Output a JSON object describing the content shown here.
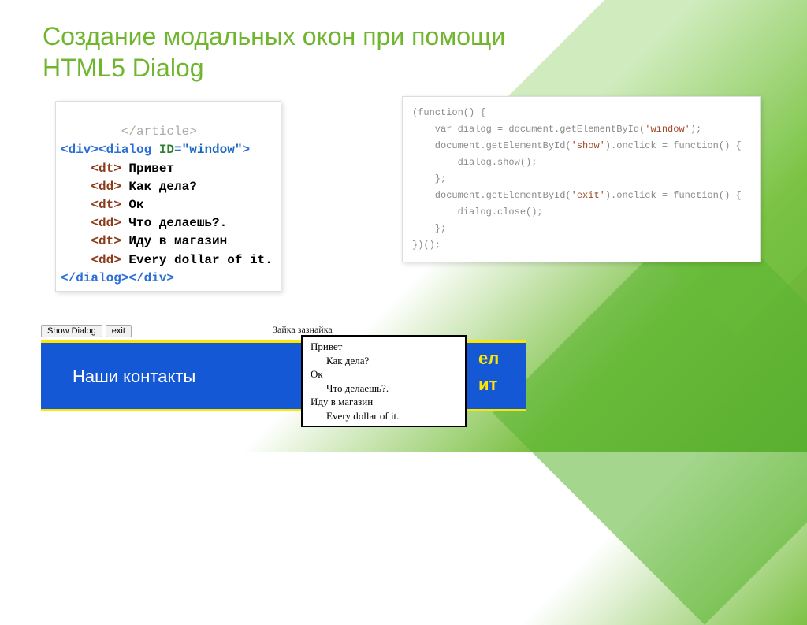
{
  "title_line1": "Создание модальных окон при помощи",
  "title_line2": "HTML5 Dialog",
  "code_left": {
    "l0": "</article>",
    "open_div": "<div>",
    "open_dialog": "<dialog ",
    "attr_id": "ID",
    "eq": "=",
    "val_window": "\"window\"",
    "gt": ">",
    "dt1a": "<dt>",
    "dt1t": " Привет",
    "dd1a": "<dd>",
    "dd1t": " Как дела?",
    "dt2a": "<dt>",
    "dt2t": " Ок",
    "dd2a": "<dd>",
    "dd2t": " Что делаешь?.",
    "dt3a": "<dt>",
    "dt3t": " Иду в магазин",
    "dd3a": "<dd>",
    "dd3t": " Every dollar of it.",
    "close_dialog": "</dialog>",
    "close_div": "</div>"
  },
  "code_right": {
    "l1": "(function() {",
    "l2a": "    var dialog = document.getElementById(",
    "l2s": "'window'",
    "l2b": ");",
    "l3a": "    document.getElementById(",
    "l3s": "'show'",
    "l3b": ").onclick = function() {",
    "l4": "        dialog.show();",
    "l5": "    };",
    "l6a": "    document.getElementById(",
    "l6s": "'exit'",
    "l6b": ").onclick = function() {",
    "l7": "        dialog.close();",
    "l8": "    };",
    "l9": "})();"
  },
  "btn_show": "Show Dialog",
  "btn_exit": "exit",
  "small_label": "Зайка зазнайка",
  "contacts": "Наши контакты",
  "yellow1": "ел",
  "yellow2": "ит",
  "dialog": {
    "dt1": "Привет",
    "dd1": "Как дела?",
    "dt2": "Ок",
    "dd2": "Что делаешь?.",
    "dt3": "Иду в магазин",
    "dd3": "Every dollar of it."
  }
}
